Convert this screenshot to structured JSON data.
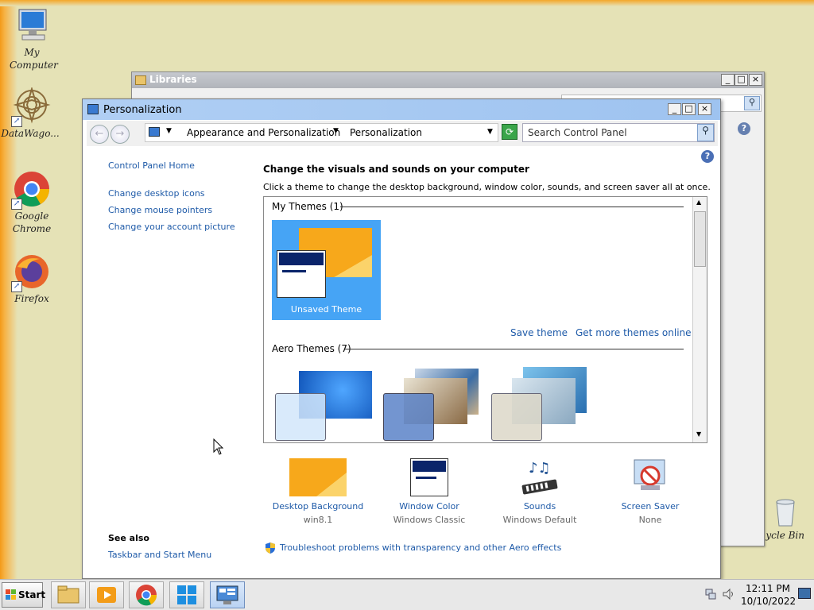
{
  "desktop": {
    "icons": [
      {
        "label": "My Computer",
        "name": "my-computer"
      },
      {
        "label": "DataWago...",
        "name": "datawago"
      },
      {
        "label": "Google Chrome",
        "name": "google-chrome"
      },
      {
        "label": "Firefox",
        "name": "firefox"
      },
      {
        "label": "ycle Bin",
        "name": "recycle-bin"
      }
    ]
  },
  "libraries_window": {
    "title": "Libraries"
  },
  "window": {
    "title": "Personalization",
    "breadcrumb": [
      "Appearance and Personalization",
      "Personalization"
    ],
    "search_placeholder": "Search Control Panel"
  },
  "left_nav": {
    "home": "Control Panel Home",
    "links": [
      "Change desktop icons",
      "Change mouse pointers",
      "Change your account picture"
    ],
    "see_also_heading": "See also",
    "see_also": [
      "Taskbar and Start Menu"
    ]
  },
  "main": {
    "heading": "Change the visuals and sounds on your computer",
    "description": "Click a theme to change the desktop background, window color, sounds, and screen saver all at once.",
    "my_themes_header": "My Themes (1)",
    "unsaved_theme": "Unsaved Theme",
    "save_theme": "Save theme",
    "more_themes": "Get more themes online",
    "aero_header": "Aero Themes (7)",
    "troubleshoot": "Troubleshoot problems with transparency and other Aero effects"
  },
  "bottom": [
    {
      "label": "Desktop Background",
      "value": "win8.1"
    },
    {
      "label": "Window Color",
      "value": "Windows Classic"
    },
    {
      "label": "Sounds",
      "value": "Windows Default"
    },
    {
      "label": "Screen Saver",
      "value": "None"
    }
  ],
  "taskbar": {
    "start": "Start",
    "time": "12:11 PM",
    "date": "10/10/2022"
  },
  "colors": {
    "title_bar": "#9ec3f0",
    "link": "#1e5aa8",
    "selected_theme": "#46a4f5",
    "win8_orange": "#f39c18"
  }
}
